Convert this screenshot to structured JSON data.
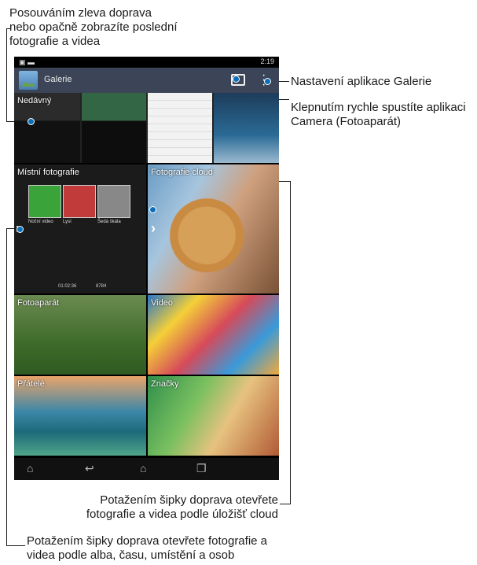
{
  "callouts": {
    "swipe_recent": "Posouváním zleva doprava\nnebo opačně zobrazíte poslední\nfotografie a videa",
    "settings": "Nastavení aplikace Galerie",
    "camera_launch": "Klepnutím rychle spustíte aplikaci\nCamera (Fotoaparát)",
    "cloud_arrow": "Potažením šipky doprava otevřete\nfotografie a videa podle úložišť cloud",
    "local_arrow": "Potažením šipky doprava otevřete fotografie a\nvidea podle alba, času, umístění a osob"
  },
  "statusbar": {
    "time": "2:19"
  },
  "actionbar": {
    "title": "Galerie"
  },
  "tiles": {
    "recent": "Nedávný",
    "local": "Místní fotografie",
    "cloud": "Fotografie cloud",
    "camera": "Fotoaparát",
    "video": "Video",
    "friends": "Přátelé",
    "tags": "Značky"
  },
  "local_counts": {
    "videos": "01:02:36",
    "photos": "8784"
  },
  "local_thumbs": [
    "Noční video",
    "Lysí",
    "Šedá škála"
  ],
  "navbar_icons": [
    "home-up-icon",
    "back-icon",
    "home-icon",
    "recent-apps-icon"
  ]
}
